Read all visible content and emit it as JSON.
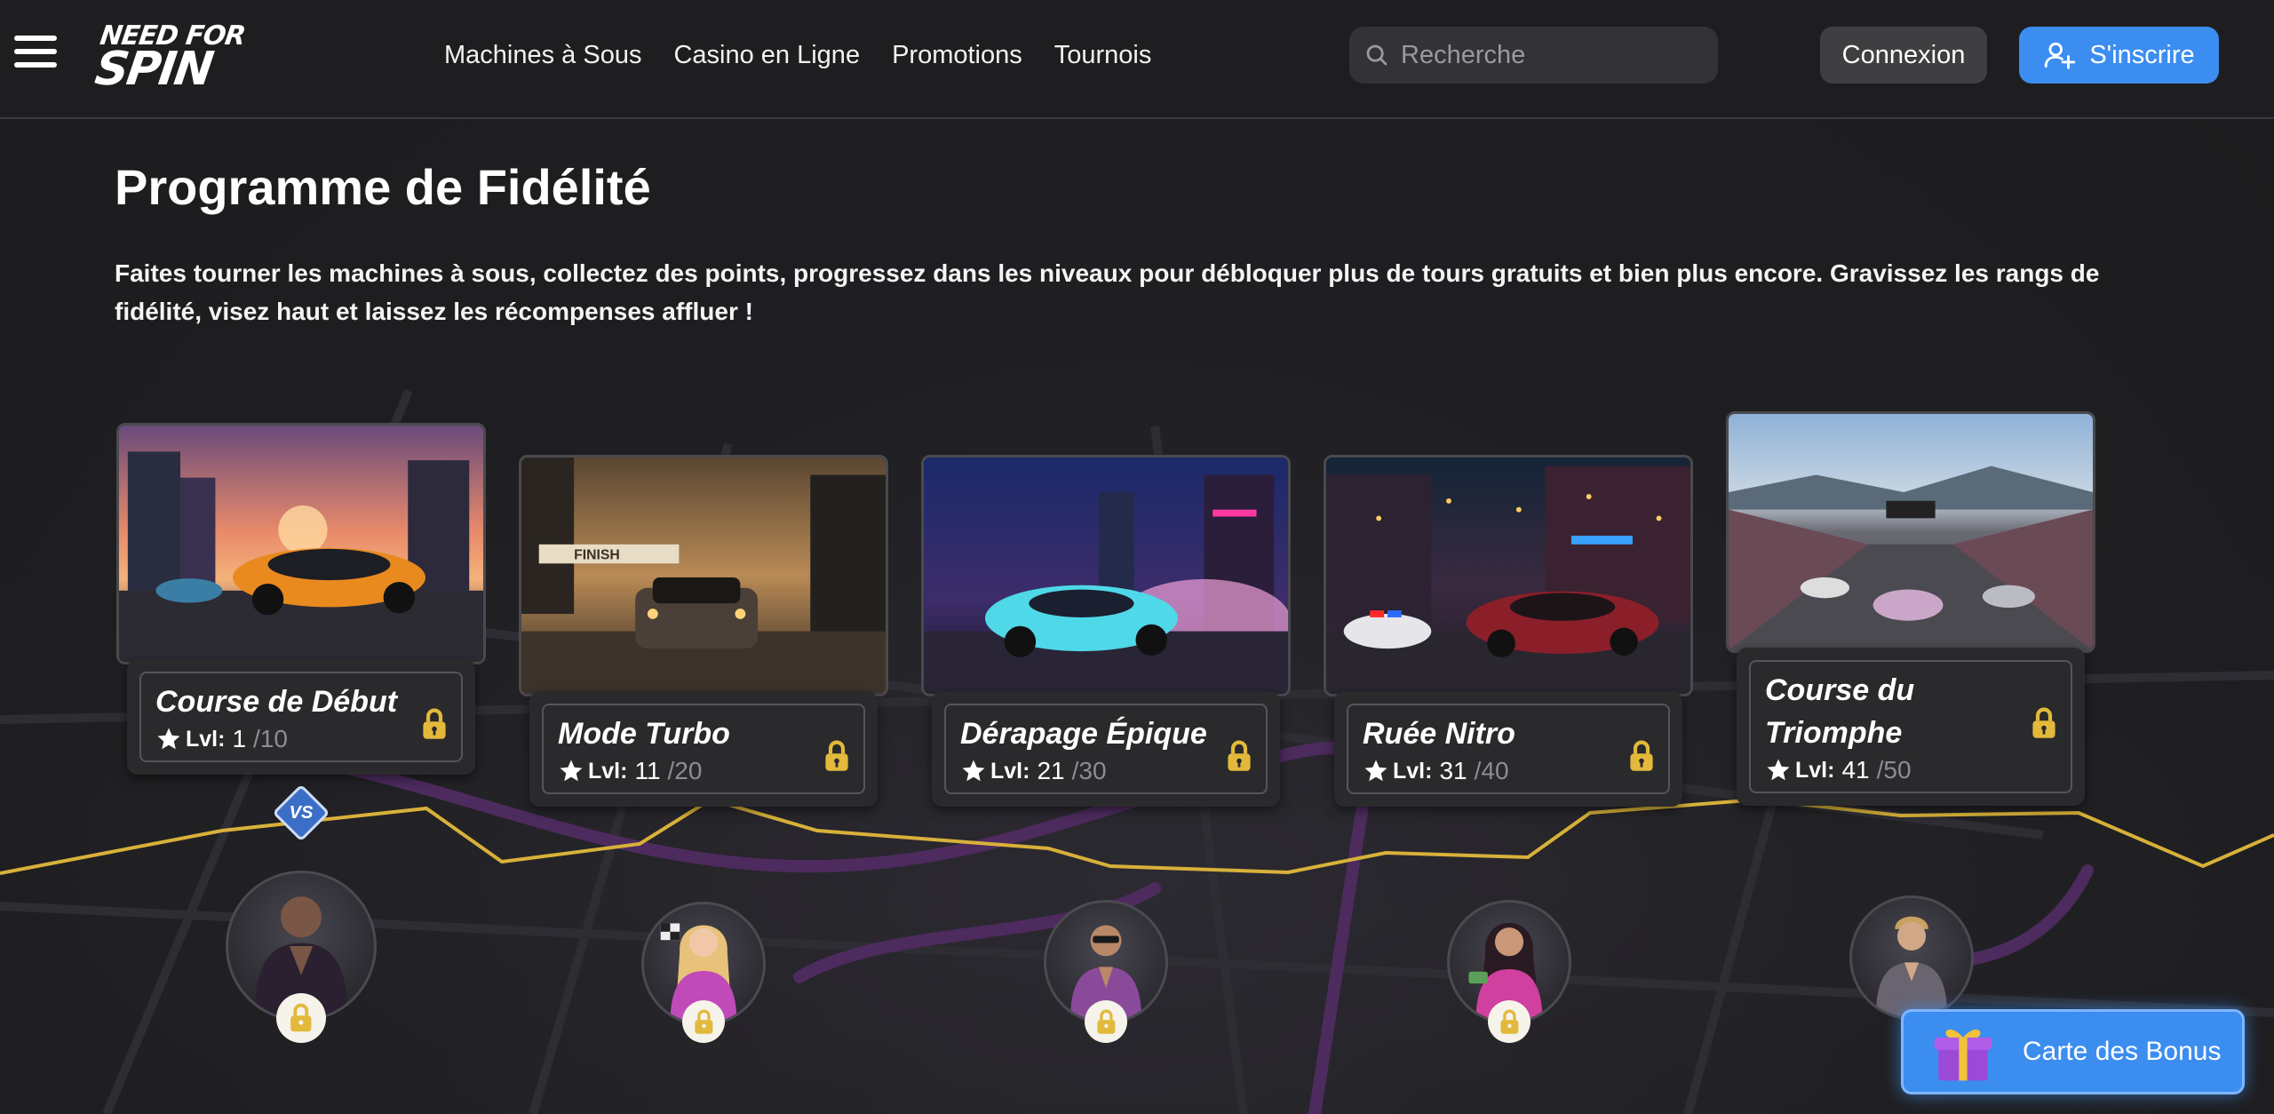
{
  "header": {
    "logo_line1": "NEED FOR",
    "logo_line2": "SPIN",
    "nav": [
      {
        "label": "Machines à Sous"
      },
      {
        "label": "Casino en Ligne"
      },
      {
        "label": "Promotions"
      },
      {
        "label": "Tournois"
      }
    ],
    "search_placeholder": "Recherche",
    "login_label": "Connexion",
    "signup_label": "S'inscrire"
  },
  "main": {
    "title": "Programme de Fidélité",
    "description": "Faites tourner les machines à sous, collectez des points, progressez dans les niveaux pour débloquer plus de tours gratuits et bien plus encore. Gravissez les rangs de fidélité, visez haut et laissez les récompenses affluer !"
  },
  "levels": [
    {
      "name": "Course de Début",
      "lvl_label": "Lvl:",
      "current": "1",
      "max": "/10",
      "locked": true
    },
    {
      "name": "Mode Turbo",
      "lvl_label": "Lvl:",
      "current": "11",
      "max": "/20",
      "locked": true
    },
    {
      "name": "Dérapage Épique",
      "lvl_label": "Lvl:",
      "current": "21",
      "max": "/30",
      "locked": true
    },
    {
      "name": "Ruée Nitro",
      "lvl_label": "Lvl:",
      "current": "31",
      "max": "/40",
      "locked": true
    },
    {
      "name": "Course du Triomphe",
      "lvl_label": "Lvl:",
      "current": "41",
      "max": "/50",
      "locked": true
    }
  ],
  "vs_badge": "VS",
  "bonus_button": "Carte des Bonus",
  "colors": {
    "background": "#1e1e20",
    "accent_blue": "#3b8df0",
    "lock_gold": "#e2b93b",
    "route_line": "#d8b13a",
    "map_road_purple": "#4d2b5e"
  }
}
